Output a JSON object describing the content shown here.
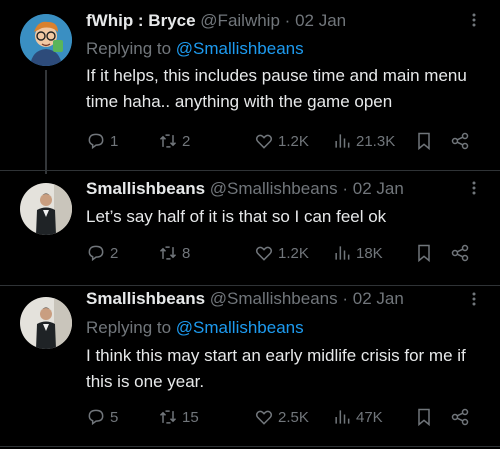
{
  "tweets": [
    {
      "display_name": "fWhip : Bryce",
      "handle": "@Failwhip",
      "separator": "·",
      "date": "02 Jan",
      "replying_prefix": "Replying to",
      "replying_to": "@Smallishbeans",
      "text": "If it helps, this includes pause time and main menu time haha.. anything with the game open",
      "replies": "1",
      "retweets": "2",
      "likes": "1.2K",
      "views": "21.3K"
    },
    {
      "display_name": "Smallishbeans",
      "handle": "@Smallishbeans",
      "separator": "·",
      "date": "02 Jan",
      "text": "Let’s say half of it is that so I can feel ok",
      "replies": "2",
      "retweets": "8",
      "likes": "1.2K",
      "views": "18K"
    },
    {
      "display_name": "Smallishbeans",
      "handle": "@Smallishbeans",
      "separator": "·",
      "date": "02 Jan",
      "replying_prefix": "Replying to",
      "replying_to": "@Smallishbeans",
      "text": "I think this may start an early midlife crisis for me if this is one year.",
      "replies": "5",
      "retweets": "15",
      "likes": "2.5K",
      "views": "47K"
    }
  ],
  "icons": {
    "reply": "comment-bubble-icon",
    "retweet": "retweet-icon",
    "like": "heart-icon",
    "views": "bar-chart-icon",
    "bookmark": "bookmark-icon",
    "share": "share-icon",
    "more": "more-dots-icon"
  },
  "colors": {
    "background": "#000000",
    "text_primary": "#e7e9ea",
    "text_secondary": "#71767b",
    "link": "#1d9bf0",
    "divider": "#2f3336"
  }
}
